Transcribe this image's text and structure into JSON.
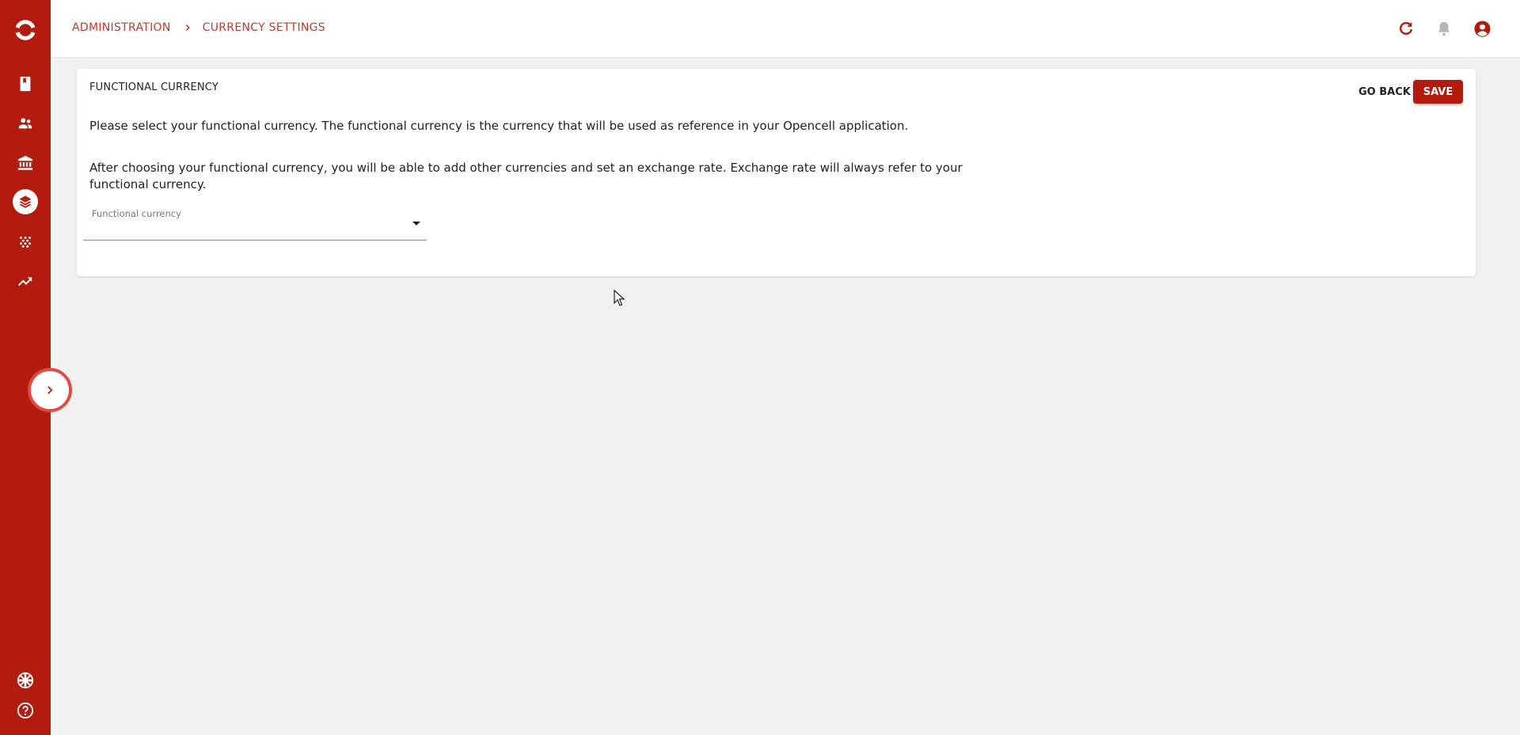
{
  "sidebar": {
    "logo": "opencell-logo",
    "items": [
      {
        "icon": "book-icon"
      },
      {
        "icon": "users-icon"
      },
      {
        "icon": "bank-icon"
      },
      {
        "icon": "layers-icon",
        "active": true
      },
      {
        "icon": "dots-grid-icon"
      },
      {
        "icon": "trending-up-icon"
      }
    ],
    "bottom": [
      {
        "icon": "uk-flag-icon"
      },
      {
        "icon": "help-icon"
      }
    ],
    "expand_icon": "chevron-right-icon"
  },
  "header": {
    "breadcrumb": [
      "ADMINISTRATION",
      "CURRENCY SETTINGS"
    ],
    "icons": [
      "refresh-icon",
      "bell-icon",
      "account-icon"
    ]
  },
  "card": {
    "title": "FUNCTIONAL CURRENCY",
    "go_back_label": "GO BACK",
    "save_label": "SAVE",
    "paragraph1": "Please select your functional currency. The functional currency is the currency that will be used as reference in your Opencell application.",
    "paragraph2": "After choosing your functional currency, you will be able to add other currencies and set an exchange rate. Exchange rate will always refer to your functional currency.",
    "select": {
      "label": "Functional currency",
      "value": ""
    }
  },
  "colors": {
    "brand": "#b31b0e",
    "breadcrumb": "#c0392b",
    "background": "#f1f1f1"
  }
}
